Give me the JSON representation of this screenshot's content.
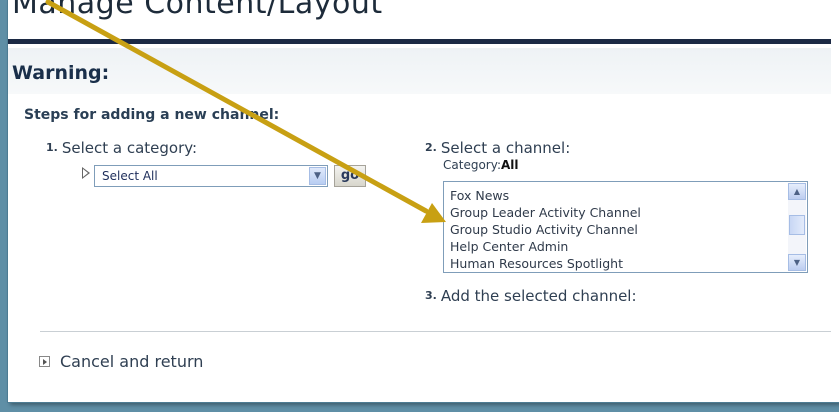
{
  "page": {
    "title": "Manage Content/Layout",
    "warning": "Warning:",
    "steps_heading": "Steps for adding a new channel:"
  },
  "step1": {
    "number": "1.",
    "label": "Select a category:",
    "select_value": "Select All",
    "go_label": "go"
  },
  "step2": {
    "number": "2.",
    "label": "Select a channel:",
    "category_prefix": "Category:",
    "category_value": "All",
    "channels": [
      "Fox News",
      "Group Leader Activity Channel",
      "Group Studio Activity Channel",
      "Help Center Admin",
      "Human Resources Spotlight"
    ]
  },
  "step3": {
    "number": "3.",
    "label": "Add the selected channel:"
  },
  "footer": {
    "cancel_label": "Cancel and return"
  },
  "colors": {
    "annotation_arrow": "#c8a013",
    "title_rule": "#1c2a44",
    "border": "#5f8fa6"
  },
  "icons": {
    "step_marker": "triangle-right-icon",
    "cancel": "boxed-arrow-right-icon",
    "scroll_up": "chevron-up-icon",
    "scroll_down": "chevron-down-icon"
  }
}
